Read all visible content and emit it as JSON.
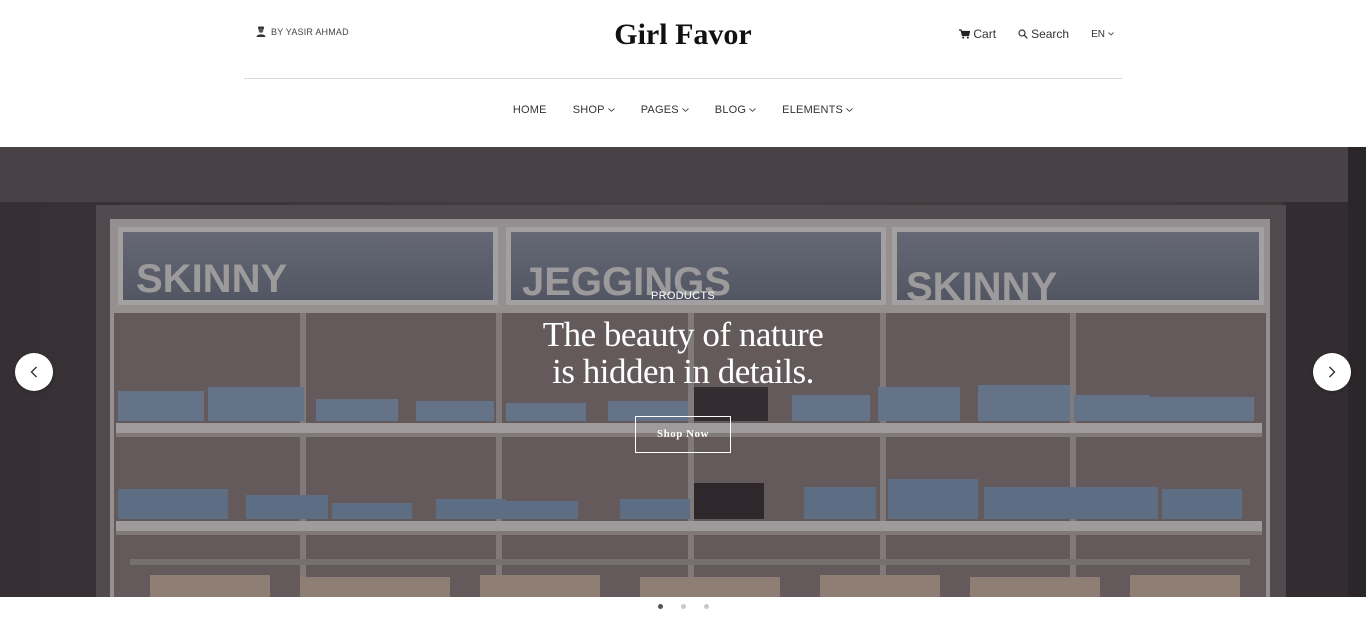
{
  "header": {
    "author": "BY YASIR AHMAD",
    "logo": "Girl Favor",
    "cart_label": "Cart",
    "search_label": "Search",
    "language": "EN"
  },
  "nav": {
    "items": [
      {
        "label": "HOME",
        "dropdown": false
      },
      {
        "label": "SHOP",
        "dropdown": true
      },
      {
        "label": "PAGES",
        "dropdown": true
      },
      {
        "label": "BLOG",
        "dropdown": true
      },
      {
        "label": "ELEMENTS",
        "dropdown": true
      }
    ]
  },
  "hero": {
    "subtitle": "PRODUCTS",
    "title_line1": "The beauty of nature",
    "title_line2": "is hidden in details.",
    "button_label": "Shop Now",
    "sign_texts": [
      "SKINNY",
      "JEGGINGS",
      "SKINNY"
    ]
  },
  "slider": {
    "slide_count": 3,
    "active_index": 0
  },
  "colors": {
    "text_dark": "#111111",
    "hero_text": "#ffffff",
    "divider": "#d9d9d9"
  },
  "icons": {
    "author": "user-icon",
    "cart": "cart-icon",
    "search": "search-icon",
    "lang": "chevron-down-icon",
    "prev": "chevron-left-icon",
    "next": "chevron-right-icon"
  }
}
